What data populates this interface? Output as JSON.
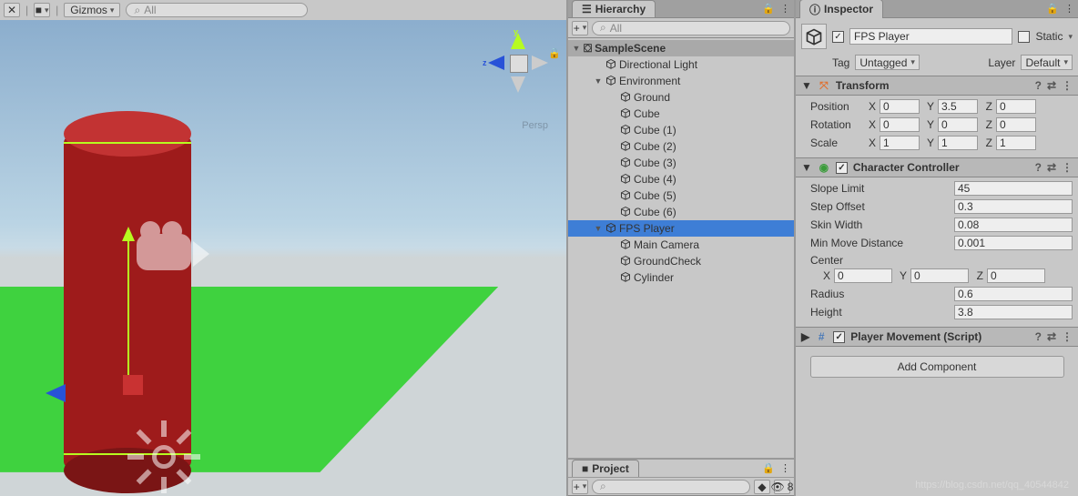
{
  "scene": {
    "toolbar": {
      "gizmos": "Gizmos",
      "search_placeholder": "All"
    },
    "gizmo": {
      "y": "y",
      "z": "z",
      "persp": "Persp"
    }
  },
  "hierarchy": {
    "title": "Hierarchy",
    "search_placeholder": "All",
    "root": "SampleScene",
    "items": [
      {
        "label": "Directional Light",
        "depth": 1,
        "fold": "",
        "sel": false
      },
      {
        "label": "Environment",
        "depth": 1,
        "fold": "▼",
        "sel": false
      },
      {
        "label": "Ground",
        "depth": 2,
        "fold": "",
        "sel": false
      },
      {
        "label": "Cube",
        "depth": 2,
        "fold": "",
        "sel": false
      },
      {
        "label": "Cube (1)",
        "depth": 2,
        "fold": "",
        "sel": false
      },
      {
        "label": "Cube (2)",
        "depth": 2,
        "fold": "",
        "sel": false
      },
      {
        "label": "Cube (3)",
        "depth": 2,
        "fold": "",
        "sel": false
      },
      {
        "label": "Cube (4)",
        "depth": 2,
        "fold": "",
        "sel": false
      },
      {
        "label": "Cube (5)",
        "depth": 2,
        "fold": "",
        "sel": false
      },
      {
        "label": "Cube (6)",
        "depth": 2,
        "fold": "",
        "sel": false
      },
      {
        "label": "FPS Player",
        "depth": 1,
        "fold": "▼",
        "sel": true
      },
      {
        "label": "Main Camera",
        "depth": 2,
        "fold": "",
        "sel": false
      },
      {
        "label": "GroundCheck",
        "depth": 2,
        "fold": "",
        "sel": false
      },
      {
        "label": "Cylinder",
        "depth": 2,
        "fold": "",
        "sel": false
      }
    ]
  },
  "project": {
    "title": "Project",
    "favorites": "8",
    "search_placeholder": ""
  },
  "inspector": {
    "title": "Inspector",
    "go": {
      "name": "FPS Player",
      "static": "Static",
      "tag_lbl": "Tag",
      "tag": "Untagged",
      "layer_lbl": "Layer",
      "layer": "Default"
    },
    "transform": {
      "title": "Transform",
      "pos_lbl": "Position",
      "rot_lbl": "Rotation",
      "scale_lbl": "Scale",
      "px": "0",
      "py": "3.5",
      "pz": "0",
      "rx": "0",
      "ry": "0",
      "rz": "0",
      "sx": "1",
      "sy": "1",
      "sz": "1",
      "X": "X",
      "Y": "Y",
      "Z": "Z"
    },
    "charctrl": {
      "title": "Character Controller",
      "slope_lbl": "Slope Limit",
      "slope": "45",
      "step_lbl": "Step Offset",
      "step": "0.3",
      "skin_lbl": "Skin Width",
      "skin": "0.08",
      "mmd_lbl": "Min Move Distance",
      "mmd": "0.001",
      "center_lbl": "Center",
      "cx": "0",
      "cy": "0",
      "cz": "0",
      "radius_lbl": "Radius",
      "radius": "0.6",
      "height_lbl": "Height",
      "height": "3.8",
      "X": "X",
      "Y": "Y",
      "Z": "Z"
    },
    "script": {
      "title": "Player Movement (Script)"
    },
    "add_btn": "Add Component"
  },
  "watermark": "https://blog.csdn.net/qq_40544842"
}
